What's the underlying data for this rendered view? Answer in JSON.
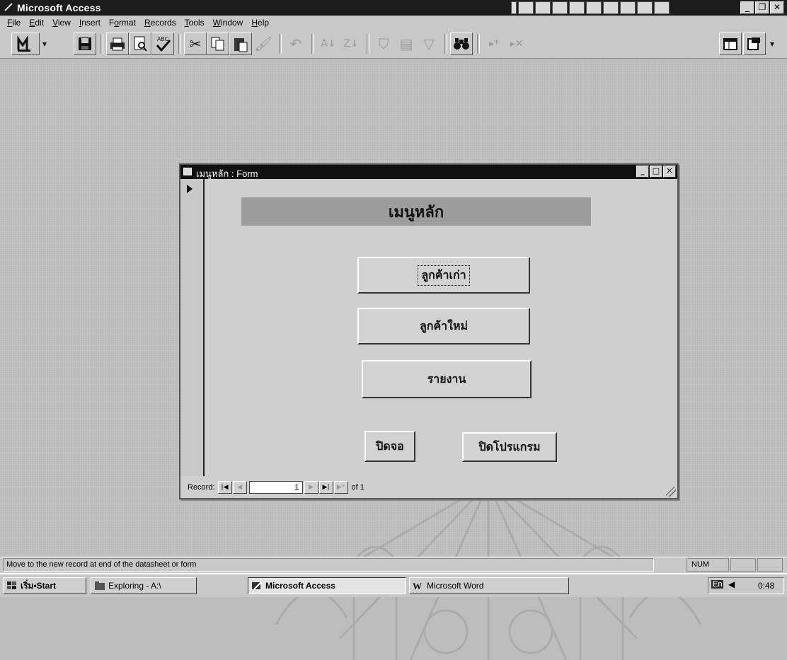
{
  "app": {
    "title": "Microsoft Access"
  },
  "menu": [
    {
      "label": "File",
      "u": "F"
    },
    {
      "label": "Edit",
      "u": "E"
    },
    {
      "label": "View",
      "u": "V"
    },
    {
      "label": "Insert",
      "u": "I"
    },
    {
      "label": "Format",
      "u": "o"
    },
    {
      "label": "Records",
      "u": "R"
    },
    {
      "label": "Tools",
      "u": "T"
    },
    {
      "label": "Window",
      "u": "W"
    },
    {
      "label": "Help",
      "u": "H"
    }
  ],
  "form": {
    "title": "เมนูหลัก : Form",
    "header": "เมนูหลัก",
    "buttons": {
      "old_customer": "ลูกค้าเก่า",
      "new_customer": "ลูกค้าใหม่",
      "report": "รายงาน",
      "close_screen": "ปิดจอ",
      "close_program": "ปิดโปรแกรม"
    },
    "record_nav": {
      "label": "Record:",
      "current": "1",
      "of_text": "of 1"
    }
  },
  "status": {
    "message": "Move to the new record at end of the datasheet or form",
    "num": "NUM"
  },
  "taskbar": {
    "start": "เริ่ม•Start",
    "tasks": [
      "Exploring - A:\\",
      "Microsoft Access",
      "Microsoft Word"
    ],
    "clock": "0:48",
    "lang": "En"
  },
  "colors": {
    "titlebar": "#1c1c1c",
    "face": "#c8c8c8",
    "header_band": "#9c9c9c"
  }
}
